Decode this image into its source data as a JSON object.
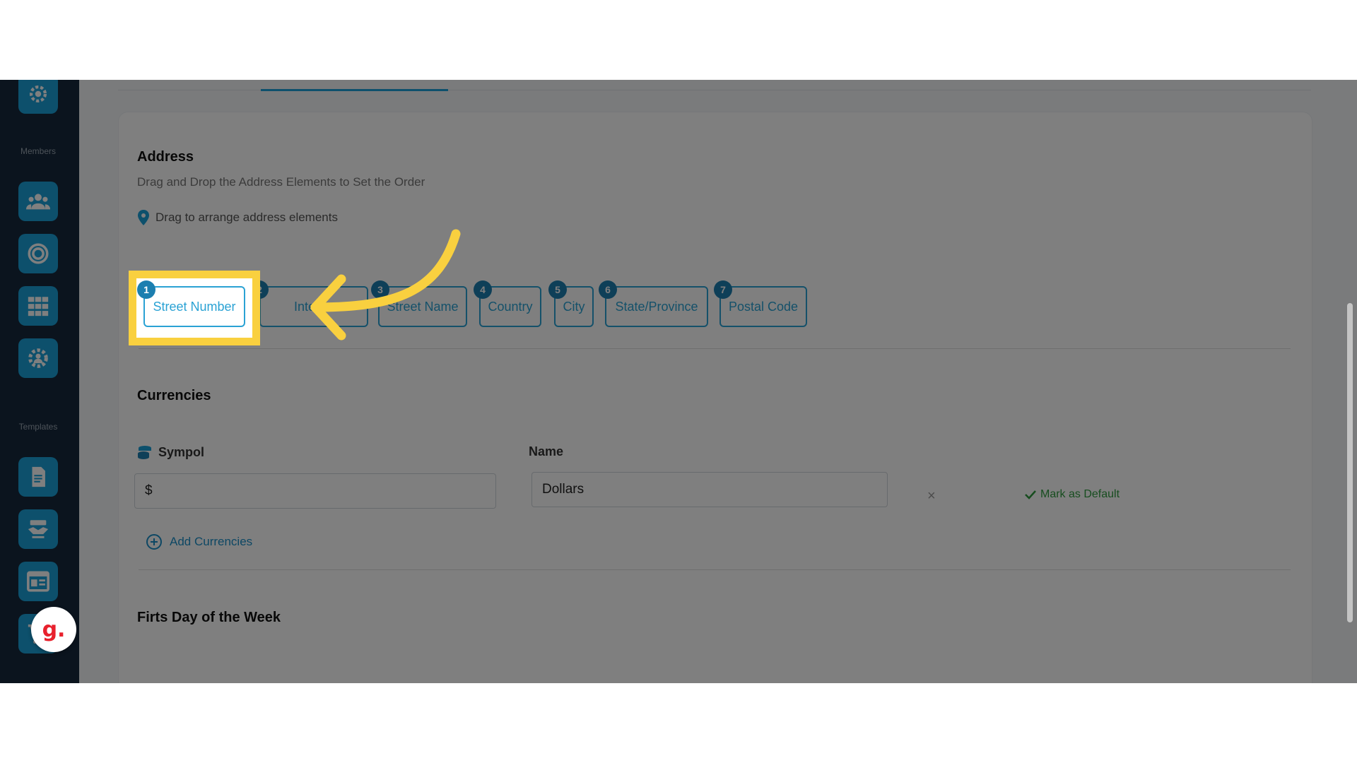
{
  "sidebar": {
    "members_label": "Members",
    "templates_label": "Templates",
    "buttons": [
      "settings-icon",
      "users-icon",
      "target-icon",
      "grid-icon",
      "gear-icon",
      "document-icon",
      "handshake-icon",
      "layout-icon",
      "cart-icon"
    ],
    "badge": "g."
  },
  "address": {
    "title": "Address",
    "description": "Drag and Drop the Address Elements to Set the Order",
    "hint": "Drag to arrange address elements",
    "elements": [
      {
        "num": "1",
        "label": "Street Number"
      },
      {
        "num": "2",
        "label": "Interior"
      },
      {
        "num": "3",
        "label": "Street Name"
      },
      {
        "num": "4",
        "label": "Country"
      },
      {
        "num": "5",
        "label": "City"
      },
      {
        "num": "6",
        "label": "State/Province"
      },
      {
        "num": "7",
        "label": "Postal Code"
      }
    ]
  },
  "currencies": {
    "title": "Currencies",
    "symbol_label": "Sympol",
    "name_label": "Name",
    "symbol_value": "$",
    "name_value": "Dollars",
    "remove": "×",
    "mark_default": "Mark as Default",
    "add": "Add Currencies"
  },
  "first_day": {
    "title": "Firts Day of the Week"
  },
  "colors": {
    "accent": "#1aa0d8",
    "highlight": "#f9d03f",
    "sidebar": "#16283c",
    "success": "#2e9b3f"
  }
}
